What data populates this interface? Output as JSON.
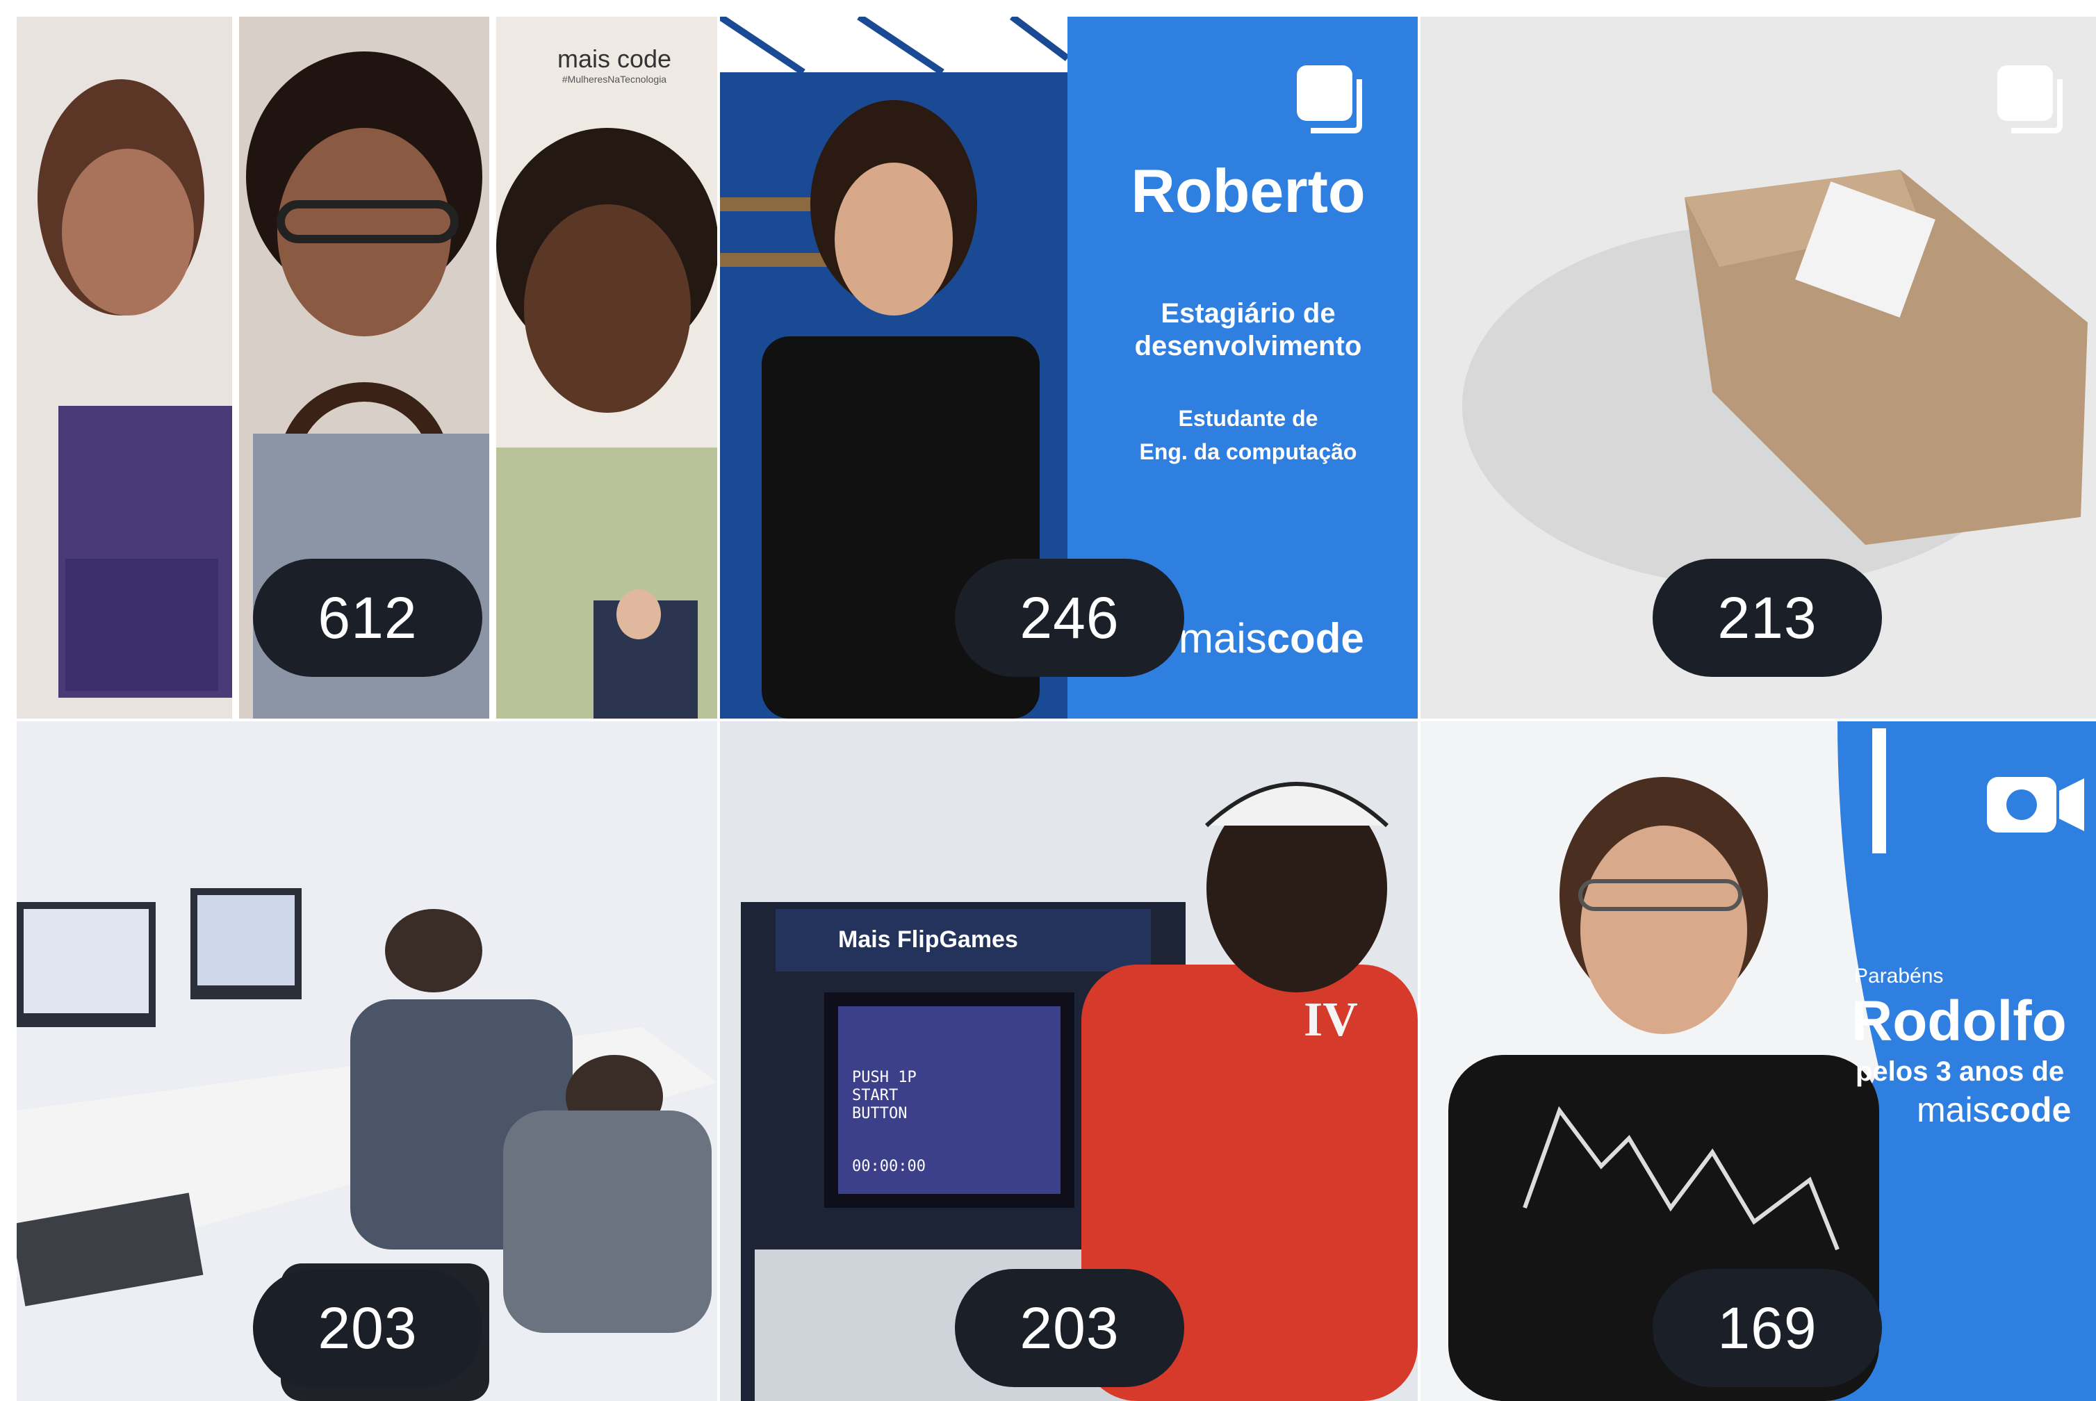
{
  "posts": [
    {
      "count": "612",
      "brand": "mais code",
      "brand_sub": "#MulheresNaTecnologia"
    },
    {
      "count": "246",
      "name": "Roberto",
      "role_line1": "Estagiário de",
      "role_line2": "desenvolvimento",
      "study_line1": "Estudante de",
      "study_line2": "Eng. da computação",
      "brand_a": "mais",
      "brand_b": "code"
    },
    {
      "count": "213"
    },
    {
      "count": "203"
    },
    {
      "count": "203",
      "game_title": "Mais FlipGames",
      "screen_line1": "PUSH 1P",
      "screen_line2": "START",
      "screen_line3": "BUTTON",
      "screen_time": "00:00:00",
      "shirt_mark": "IV"
    },
    {
      "count": "169",
      "congrats": "Parabéns",
      "name": "Rodolfo",
      "years": "pelos 3 anos de",
      "brand_a": "mais",
      "brand_b": "code"
    }
  ],
  "colors": {
    "badge_bg": "#1b1f27",
    "badge_text": "#ffffff",
    "brand_blue": "#2f7fe0"
  },
  "icons": [
    "multiple-posts-icon",
    "video-camera-icon"
  ]
}
